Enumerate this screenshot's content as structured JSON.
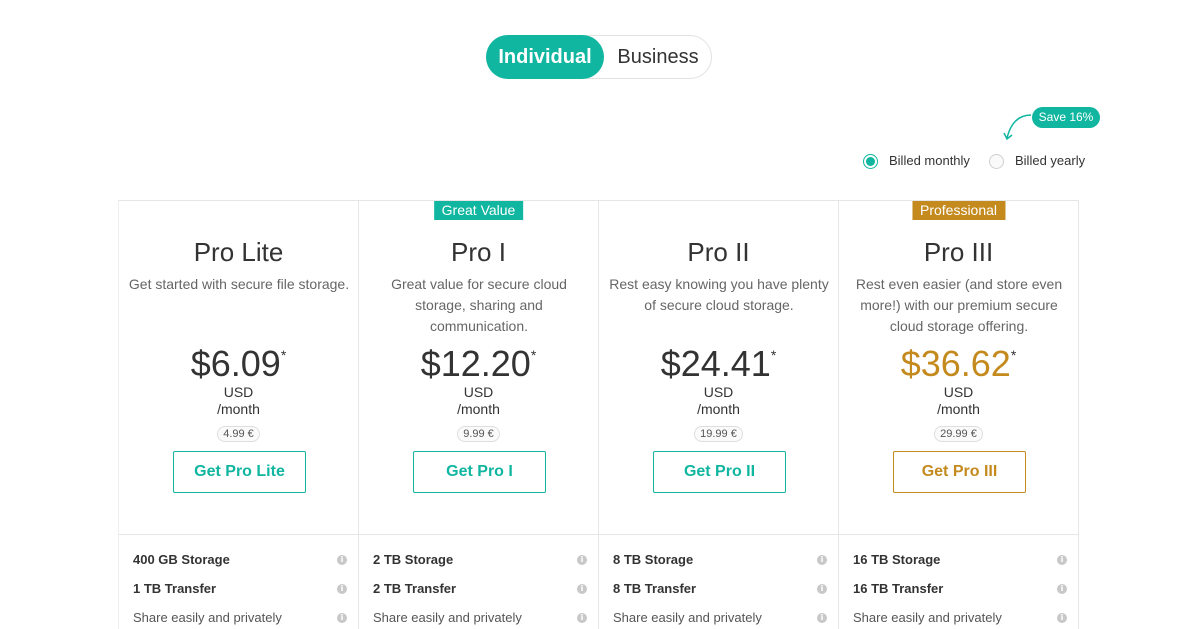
{
  "segment": {
    "individual": "Individual",
    "business": "Business"
  },
  "billing": {
    "save": "Save 16%",
    "monthly": "Billed monthly",
    "yearly": "Billed yearly",
    "selected": "monthly"
  },
  "colors": {
    "accent": "#10b6a0",
    "gold": "#c48a1e"
  },
  "plans": [
    {
      "badge": "",
      "name": "Pro Lite",
      "desc": "Get started with secure file storage.",
      "price": "$6.09",
      "asterisk": "*",
      "currency": "USD",
      "period": "/month",
      "euro": "4.99 €",
      "cta": "Get Pro Lite",
      "features": [
        "400 GB Storage",
        "1 TB Transfer",
        "Share easily and privately"
      ]
    },
    {
      "badge": "Great Value",
      "name": "Pro I",
      "desc": "Great value for secure cloud storage, sharing and communication.",
      "price": "$12.20",
      "asterisk": "*",
      "currency": "USD",
      "period": "/month",
      "euro": "9.99 €",
      "cta": "Get Pro I",
      "features": [
        "2 TB Storage",
        "2 TB Transfer",
        "Share easily and privately"
      ]
    },
    {
      "badge": "",
      "name": "Pro II",
      "desc": "Rest easy knowing you have plenty of secure cloud storage.",
      "price": "$24.41",
      "asterisk": "*",
      "currency": "USD",
      "period": "/month",
      "euro": "19.99 €",
      "cta": "Get Pro II",
      "features": [
        "8 TB Storage",
        "8 TB Transfer",
        "Share easily and privately"
      ]
    },
    {
      "badge": "Professional",
      "name": "Pro III",
      "desc": "Rest even easier (and store even more!) with our premium secure cloud storage offering.",
      "price": "$36.62",
      "asterisk": "*",
      "currency": "USD",
      "period": "/month",
      "euro": "29.99 €",
      "cta": "Get Pro III",
      "features": [
        "16 TB Storage",
        "16 TB Transfer",
        "Share easily and privately"
      ]
    }
  ],
  "info_glyph": "i"
}
